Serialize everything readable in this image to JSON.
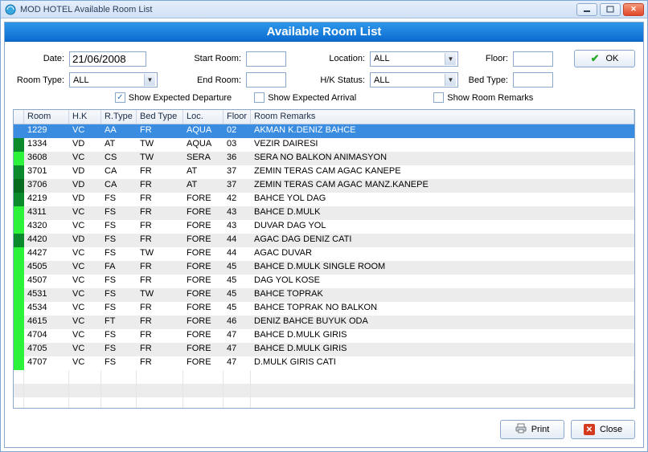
{
  "window": {
    "title": "MOD HOTEL Available Room List"
  },
  "header": {
    "title": "Available Room List"
  },
  "filters": {
    "date_label": "Date:",
    "date_value": "21/06/2008",
    "roomtype_label": "Room Type:",
    "roomtype_value": "ALL",
    "startroom_label": "Start Room:",
    "startroom_value": "",
    "endroom_label": "End Room:",
    "endroom_value": "",
    "location_label": "Location:",
    "location_value": "ALL",
    "hkstatus_label": "H/K Status:",
    "hkstatus_value": "ALL",
    "floor_label": "Floor:",
    "floor_value": "",
    "bedtype_label": "Bed Type:",
    "bedtype_value": "",
    "ok_label": "OK"
  },
  "checks": {
    "show_expected_departure": "Show Expected Departure",
    "show_expected_arrival": "Show Expected Arrival",
    "show_room_remarks": "Show Room Remarks"
  },
  "columns": {
    "room": "Room",
    "hk": "H.K",
    "rtype": "R.Type",
    "bed": "Bed Type",
    "loc": "Loc.",
    "floor": "Floor",
    "remarks": "Room Remarks"
  },
  "marker_colors": {
    "sel": "#3a8ce0",
    "dark": "#0a8a2c",
    "bright": "#2cf23c",
    "darker": "#056b1f"
  },
  "rows": [
    {
      "marker": "sel",
      "room": "1229",
      "hk": "VC",
      "rtype": "AA",
      "bed": "FR",
      "loc": "AQUA",
      "floor": "02",
      "remarks": "AKMAN K.DENIZ BAHCE",
      "selected": true
    },
    {
      "marker": "dark",
      "room": "1334",
      "hk": "VD",
      "rtype": "AT",
      "bed": "TW",
      "loc": "AQUA",
      "floor": "03",
      "remarks": "VEZIR DAIRESI"
    },
    {
      "marker": "bright",
      "room": "3608",
      "hk": "VC",
      "rtype": "CS",
      "bed": "TW",
      "loc": "SERA",
      "floor": "36",
      "remarks": "SERA NO BALKON                        ANIMASYON"
    },
    {
      "marker": "dark",
      "room": "3701",
      "hk": "VD",
      "rtype": "CA",
      "bed": "FR",
      "loc": "AT",
      "floor": "37",
      "remarks": "ZEMIN TERAS CAM AGAC KANEPE"
    },
    {
      "marker": "darker",
      "room": "3706",
      "hk": "VD",
      "rtype": "CA",
      "bed": "FR",
      "loc": "AT",
      "floor": "37",
      "remarks": "ZEMIN TERAS CAM AGAC MANZ.KANEPE"
    },
    {
      "marker": "dark",
      "room": "4219",
      "hk": "VD",
      "rtype": "FS",
      "bed": "FR",
      "loc": "FORE",
      "floor": "42",
      "remarks": "BAHCE YOL DAG"
    },
    {
      "marker": "bright",
      "room": "4311",
      "hk": "VC",
      "rtype": "FS",
      "bed": "FR",
      "loc": "FORE",
      "floor": "43",
      "remarks": "BAHCE D.MULK"
    },
    {
      "marker": "bright",
      "room": "4320",
      "hk": "VC",
      "rtype": "FS",
      "bed": "FR",
      "loc": "FORE",
      "floor": "43",
      "remarks": "DUVAR DAG YOL"
    },
    {
      "marker": "dark",
      "room": "4420",
      "hk": "VD",
      "rtype": "FS",
      "bed": "FR",
      "loc": "FORE",
      "floor": "44",
      "remarks": "AGAC DAG DENIZ CATI"
    },
    {
      "marker": "bright",
      "room": "4427",
      "hk": "VC",
      "rtype": "FS",
      "bed": "TW",
      "loc": "FORE",
      "floor": "44",
      "remarks": "AGAC DUVAR"
    },
    {
      "marker": "bright",
      "room": "4505",
      "hk": "VC",
      "rtype": "FA",
      "bed": "FR",
      "loc": "FORE",
      "floor": "45",
      "remarks": "BAHCE D.MULK SINGLE ROOM"
    },
    {
      "marker": "bright",
      "room": "4507",
      "hk": "VC",
      "rtype": "FS",
      "bed": "FR",
      "loc": "FORE",
      "floor": "45",
      "remarks": "DAG YOL KOSE"
    },
    {
      "marker": "bright",
      "room": "4531",
      "hk": "VC",
      "rtype": "FS",
      "bed": "TW",
      "loc": "FORE",
      "floor": "45",
      "remarks": "BAHCE TOPRAK"
    },
    {
      "marker": "bright",
      "room": "4534",
      "hk": "VC",
      "rtype": "FS",
      "bed": "FR",
      "loc": "FORE",
      "floor": "45",
      "remarks": "BAHCE TOPRAK NO BALKON"
    },
    {
      "marker": "bright",
      "room": "4615",
      "hk": "VC",
      "rtype": "FT",
      "bed": "FR",
      "loc": "FORE",
      "floor": "46",
      "remarks": "DENIZ BAHCE BUYUK ODA"
    },
    {
      "marker": "bright",
      "room": "4704",
      "hk": "VC",
      "rtype": "FS",
      "bed": "FR",
      "loc": "FORE",
      "floor": "47",
      "remarks": "BAHCE D.MULK GIRIS"
    },
    {
      "marker": "bright",
      "room": "4705",
      "hk": "VC",
      "rtype": "FS",
      "bed": "FR",
      "loc": "FORE",
      "floor": "47",
      "remarks": "BAHCE D.MULK GIRIS"
    },
    {
      "marker": "bright",
      "room": "4707",
      "hk": "VC",
      "rtype": "FS",
      "bed": "FR",
      "loc": "FORE",
      "floor": "47",
      "remarks": "D.MULK GIRIS CATI"
    }
  ],
  "footer": {
    "print": "Print",
    "close": "Close"
  }
}
